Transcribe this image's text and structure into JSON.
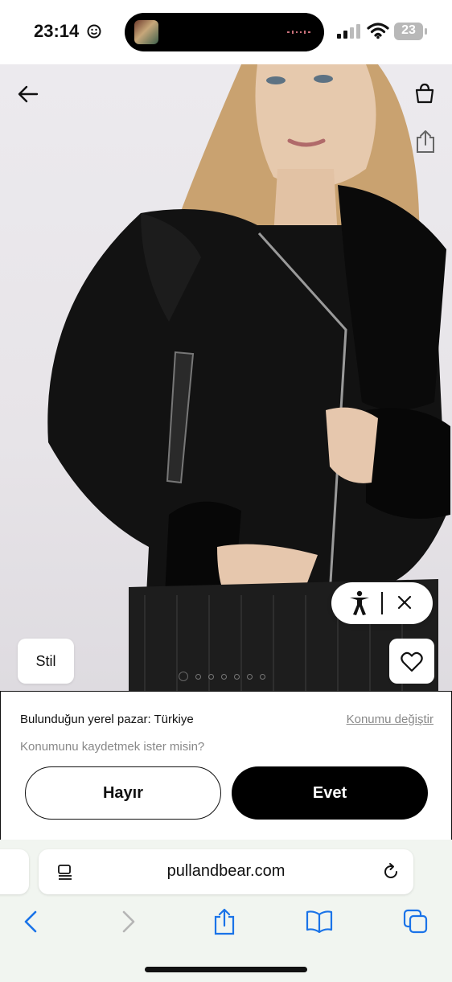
{
  "status_bar": {
    "time": "23:14",
    "battery": "23"
  },
  "product": {
    "style_button": "Stil",
    "image_count": 7,
    "active_image": 1
  },
  "location_banner": {
    "market_text": "Bulunduğun yerel pazar: Türkiye",
    "change_link": "Konumu değiştir",
    "question": "Konumunu kaydetmek ister misin?",
    "no_button": "Hayır",
    "yes_button": "Evet"
  },
  "browser": {
    "url": "pullandbear.com",
    "accent_color": "#1a73e8"
  }
}
